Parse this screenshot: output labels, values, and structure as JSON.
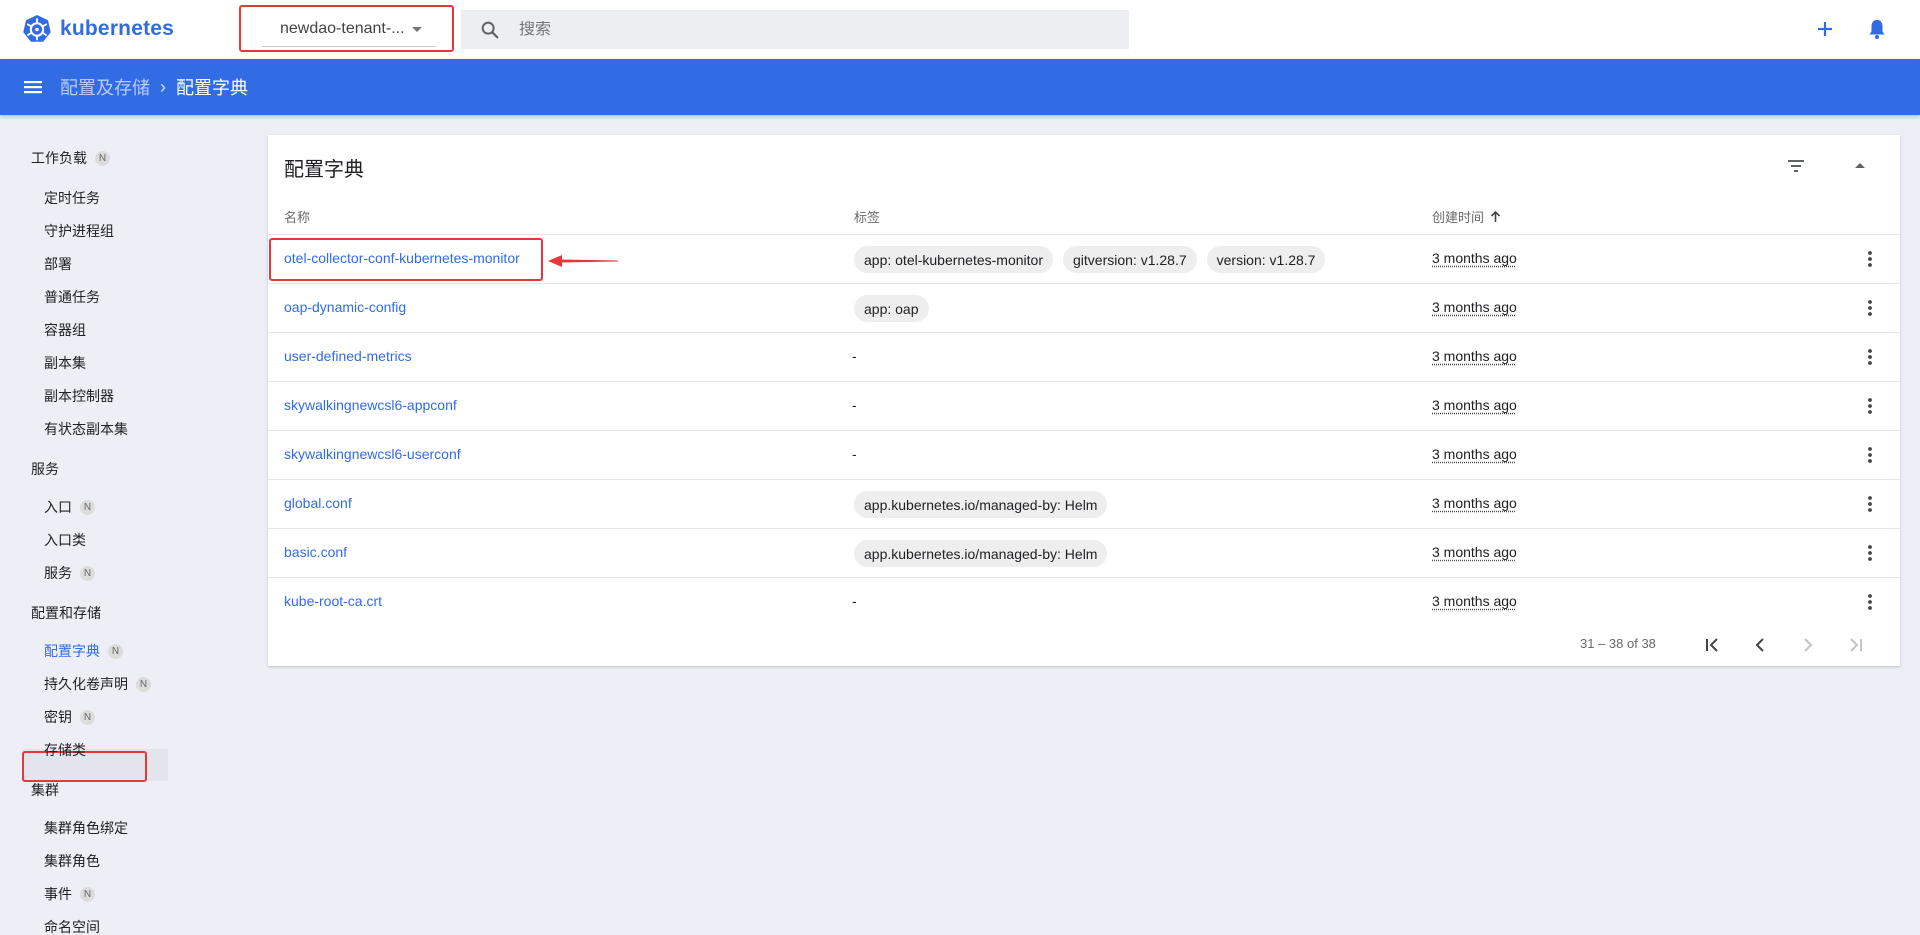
{
  "app": {
    "brand": "kubernetes",
    "brand_color": "#326ce5"
  },
  "namespace": {
    "selected": "newdao-tenant-..."
  },
  "search": {
    "placeholder": "搜索"
  },
  "breadcrumb": {
    "parent": "配置及存储",
    "separator": "›",
    "current": "配置字典"
  },
  "sidebar": {
    "sections": [
      {
        "label": "工作负载",
        "badge": "N"
      },
      {
        "label": "服务"
      },
      {
        "label": "配置和存储"
      },
      {
        "label": "集群"
      }
    ],
    "items": [
      {
        "label": "定时任务"
      },
      {
        "label": "守护进程组"
      },
      {
        "label": "部署"
      },
      {
        "label": "普通任务"
      },
      {
        "label": "容器组"
      },
      {
        "label": "副本集"
      },
      {
        "label": "副本控制器"
      },
      {
        "label": "有状态副本集"
      },
      {
        "label": "入口",
        "badge": "N"
      },
      {
        "label": "入口类"
      },
      {
        "label": "服务",
        "badge": "N"
      },
      {
        "label": "配置字典",
        "badge": "N",
        "active": true
      },
      {
        "label": "持久化卷声明",
        "badge": "N"
      },
      {
        "label": "密钥",
        "badge": "N"
      },
      {
        "label": "存储类"
      },
      {
        "label": "集群角色绑定"
      },
      {
        "label": "集群角色"
      },
      {
        "label": "事件",
        "badge": "N"
      },
      {
        "label": "命名空间"
      }
    ]
  },
  "card": {
    "title": "配置字典",
    "columns": {
      "name": "名称",
      "labels": "标签",
      "created": "创建时间"
    },
    "rows": [
      {
        "name": "otel-collector-conf-kubernetes-monitor",
        "labels": [
          "app: otel-kubernetes-monitor",
          "gitversion: v1.28.7",
          "version: v1.28.7"
        ],
        "created": "3 months ago"
      },
      {
        "name": "oap-dynamic-config",
        "labels": [
          "app: oap"
        ],
        "created": "3 months ago"
      },
      {
        "name": "user-defined-metrics",
        "labels": [],
        "empty": "-",
        "created": "3 months ago"
      },
      {
        "name": "skywalkingnewcsl6-appconf",
        "labels": [],
        "empty": "-",
        "created": "3 months ago"
      },
      {
        "name": "skywalkingnewcsl6-userconf",
        "labels": [],
        "empty": "-",
        "created": "3 months ago"
      },
      {
        "name": "global.conf",
        "labels": [
          "app.kubernetes.io/managed-by: Helm"
        ],
        "created": "3 months ago"
      },
      {
        "name": "basic.conf",
        "labels": [
          "app.kubernetes.io/managed-by: Helm"
        ],
        "created": "3 months ago"
      },
      {
        "name": "kube-root-ca.crt",
        "labels": [],
        "empty": "-",
        "created": "3 months ago"
      }
    ],
    "pagination": {
      "range": "31 – 38 of 38"
    }
  },
  "annotation_color": "#e5383b"
}
